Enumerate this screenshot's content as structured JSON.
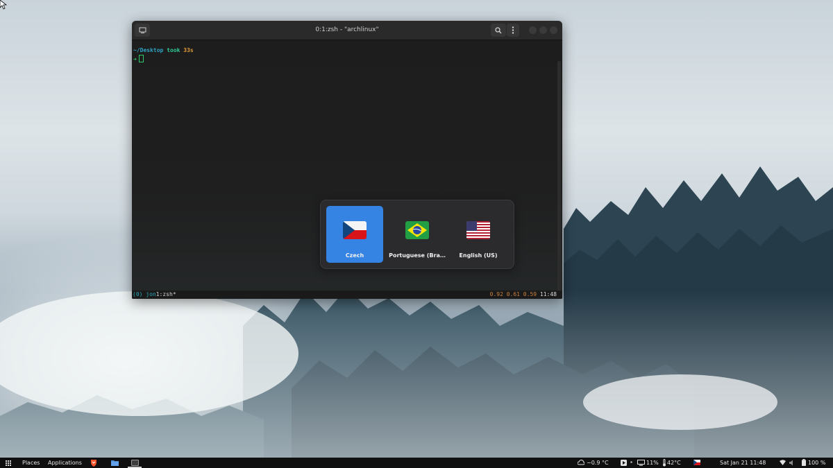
{
  "terminal": {
    "title": "0:1:zsh - \"archlinux\"",
    "prompt": {
      "path": "~/Desktop",
      "took": "took",
      "duration": "33s",
      "arrow": "➜"
    },
    "tmux": {
      "session": "(0)",
      "user": "jon",
      "window": "1:zsh*",
      "load": "0.92 0.61 0.59",
      "clock": "11:48"
    }
  },
  "input_switcher": {
    "sources": [
      {
        "label": "Czech",
        "flag": "flag-czech-icon",
        "selected": true
      },
      {
        "label": "Portuguese (Bra…",
        "flag": "flag-brazil-icon",
        "selected": false
      },
      {
        "label": "English (US)",
        "flag": "flag-usa-icon",
        "selected": false
      }
    ]
  },
  "taskbar": {
    "places": "Places",
    "applications": "Applications",
    "weather": "−0.9 °C",
    "battery_percent": "11%",
    "temperature": "42°C",
    "datetime": "Sat Jan 21  11:48",
    "volume": "100 %",
    "colors": {
      "accent": "#3584e4",
      "background": "#101010"
    }
  }
}
